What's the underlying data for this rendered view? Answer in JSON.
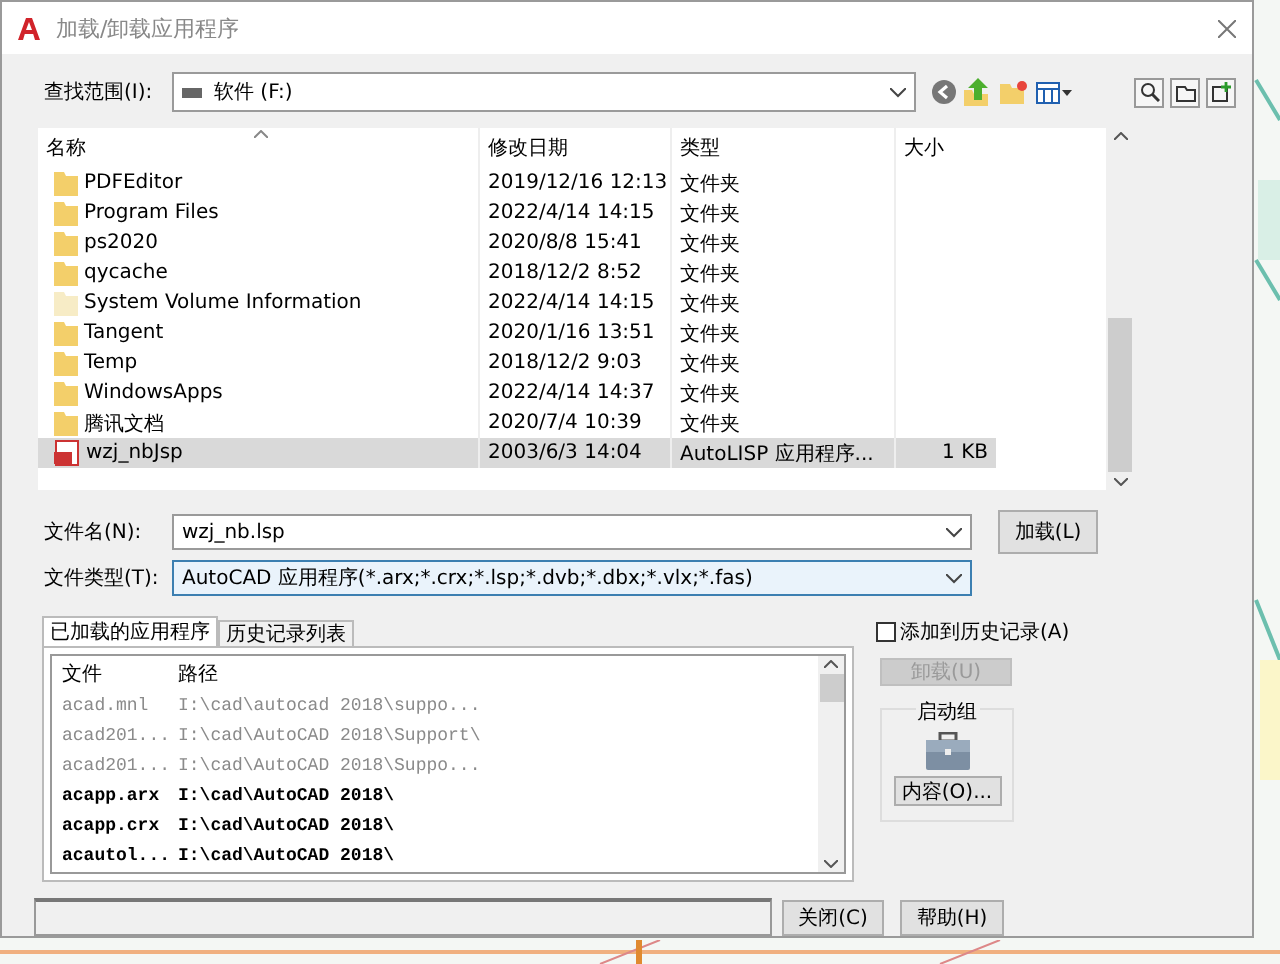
{
  "window": {
    "title": "加载/卸载应用程序"
  },
  "look_in": {
    "label": "查找范围(I):",
    "value": "软件 (F:)"
  },
  "file_list": {
    "columns": [
      "名称",
      "修改日期",
      "类型",
      "大小"
    ],
    "rows": [
      {
        "kind": "folder",
        "name": "PDFEditor",
        "date": "2019/12/16 12:13",
        "type": "文件夹",
        "selected": false
      },
      {
        "kind": "folder",
        "name": "Program Files",
        "date": "2022/4/14 14:15",
        "type": "文件夹",
        "selected": false
      },
      {
        "kind": "folder",
        "name": "ps2020",
        "date": "2020/8/8 15:41",
        "type": "文件夹",
        "selected": false
      },
      {
        "kind": "folder",
        "name": "qycache",
        "date": "2018/12/2 8:52",
        "type": "文件夹",
        "selected": false
      },
      {
        "kind": "hidden_folder",
        "name": "System Volume Information",
        "date": "2022/4/14 14:15",
        "type": "文件夹",
        "selected": false
      },
      {
        "kind": "folder",
        "name": "Tangent",
        "date": "2020/1/16 13:51",
        "type": "文件夹",
        "selected": false
      },
      {
        "kind": "folder",
        "name": "Temp",
        "date": "2018/12/2 9:03",
        "type": "文件夹",
        "selected": false
      },
      {
        "kind": "folder",
        "name": "WindowsApps",
        "date": "2022/4/14 14:37",
        "type": "文件夹",
        "selected": false
      },
      {
        "kind": "folder",
        "name": "腾讯文档",
        "date": "2020/7/4 10:39",
        "type": "文件夹",
        "selected": false
      },
      {
        "kind": "lisp_file",
        "name": "wzj_nbJsp",
        "date": "2003/6/3 14:04",
        "type": "AutoLISP 应用程序...",
        "size": "1 KB",
        "selected": true
      }
    ]
  },
  "file_name": {
    "label": "文件名(N):",
    "value": "wzj_nb.lsp"
  },
  "file_type": {
    "label": "文件类型(T):",
    "value": "AutoCAD 应用程序(*.arx;*.crx;*.lsp;*.dvb;*.dbx;*.vlx;*.fas)"
  },
  "load_button": "加载(L)",
  "tabs": [
    {
      "label": "已加载的应用程序",
      "selected": true
    },
    {
      "label": "历史记录列表",
      "selected": false
    }
  ],
  "loaded_apps": {
    "columns": [
      "文件",
      "路径"
    ],
    "rows": [
      {
        "file": "acad.mnl",
        "path": "I:\\cad\\autocad 2018\\suppo...",
        "dimmed": true
      },
      {
        "file": "acad201...",
        "path": "I:\\cad\\AutoCAD 2018\\Support\\",
        "dimmed": true
      },
      {
        "file": "acad201...",
        "path": "I:\\cad\\AutoCAD 2018\\Suppo...",
        "dimmed": true
      },
      {
        "file": "acapp.arx",
        "path": "I:\\cad\\AutoCAD 2018\\",
        "dimmed": false
      },
      {
        "file": "acapp.crx",
        "path": "I:\\cad\\AutoCAD 2018\\",
        "dimmed": false
      },
      {
        "file": "acautol...",
        "path": "I:\\cad\\AutoCAD 2018\\",
        "dimmed": false
      }
    ]
  },
  "add_to_history": {
    "label": "添加到历史记录(A)",
    "checked": false
  },
  "unload_button": {
    "label": "卸载(U)",
    "disabled": true
  },
  "startup_suite": {
    "title": "启动组",
    "button": "内容(O)..."
  },
  "buttons": [
    "关闭(C)",
    "帮助(H)"
  ]
}
